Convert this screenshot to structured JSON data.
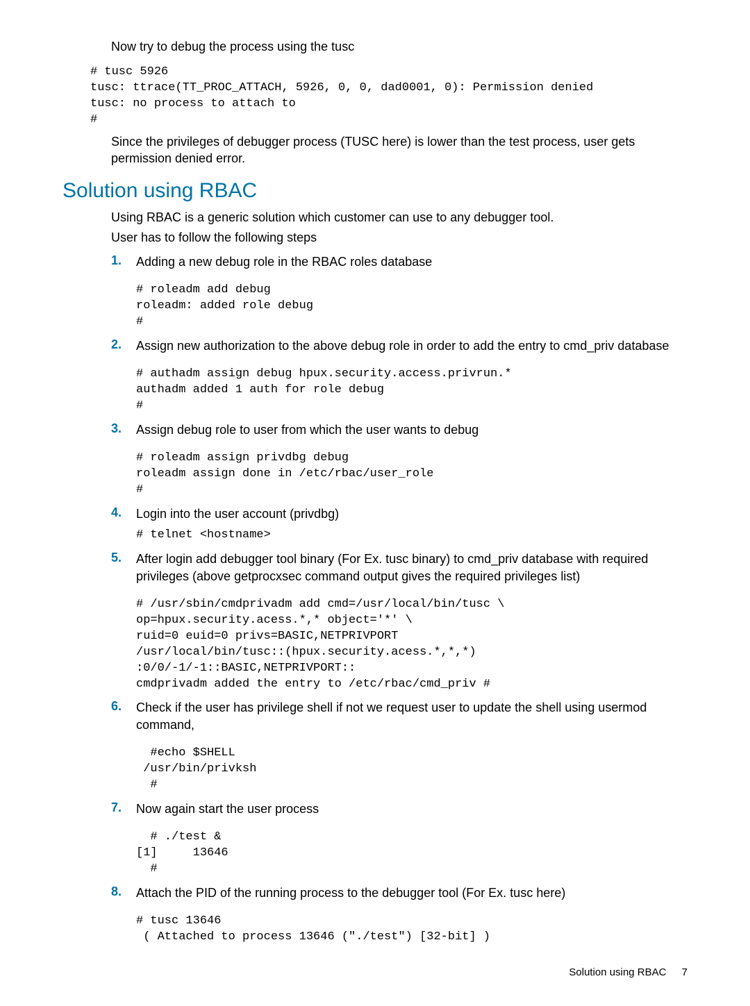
{
  "intro_text": "Now try to debug the process using the tusc",
  "code_block_1": "# tusc 5926\ntusc: ttrace(TT_PROC_ATTACH, 5926, 0, 0, dad0001, 0): Permission denied\ntusc: no process to attach to\n#",
  "after_code_text": "Since the privileges of debugger process (TUSC here) is lower than the test process, user gets permission denied error.",
  "section_heading": "Solution using RBAC",
  "rbac_intro_1": "Using RBAC is a generic solution which customer can use to any debugger tool.",
  "rbac_intro_2": "User has to follow the following steps",
  "steps": [
    {
      "text": "Adding a new debug role in the RBAC roles database",
      "code": "# roleadm add debug\nroleadm: added role debug\n#"
    },
    {
      "text": "Assign new authorization to the above debug role in order to add the entry to cmd_priv database",
      "code": "# authadm assign debug hpux.security.access.privrun.*\nauthadm added 1 auth for role debug\n#"
    },
    {
      "text": "Assign debug role to user from which the user wants to debug",
      "code": "# roleadm assign privdbg debug\nroleadm assign done in /etc/rbac/user_role\n#"
    },
    {
      "text": "Login into the user account (privdbg)",
      "code": "# telnet <hostname>"
    },
    {
      "text": "After login add debugger tool binary (For Ex. tusc binary) to cmd_priv database with required privileges (above getprocxsec command output gives the required privileges list)",
      "code": "# /usr/sbin/cmdprivadm add cmd=/usr/local/bin/tusc \\\nop=hpux.security.acess.*,* object='*' \\\nruid=0 euid=0 privs=BASIC,NETPRIVPORT\n/usr/local/bin/tusc::(hpux.security.acess.*,*,*)\n:0/0/-1/-1::BASIC,NETPRIVPORT::\ncmdprivadm added the entry to /etc/rbac/cmd_priv #"
    },
    {
      "text": "Check if the user has privilege shell if not we request user to update the shell using usermod command,",
      "code": "  #echo $SHELL\n /usr/bin/privksh\n  #"
    },
    {
      "text": "Now again start the user process",
      "code": "  # ./test &\n[1]     13646\n  #"
    },
    {
      "text": "Attach the PID of the running process to the debugger tool (For Ex. tusc here)",
      "code": "# tusc 13646\n ( Attached to process 13646 (\"./test\") [32-bit] )"
    }
  ],
  "footer_text": "Solution using RBAC",
  "footer_page": "7"
}
